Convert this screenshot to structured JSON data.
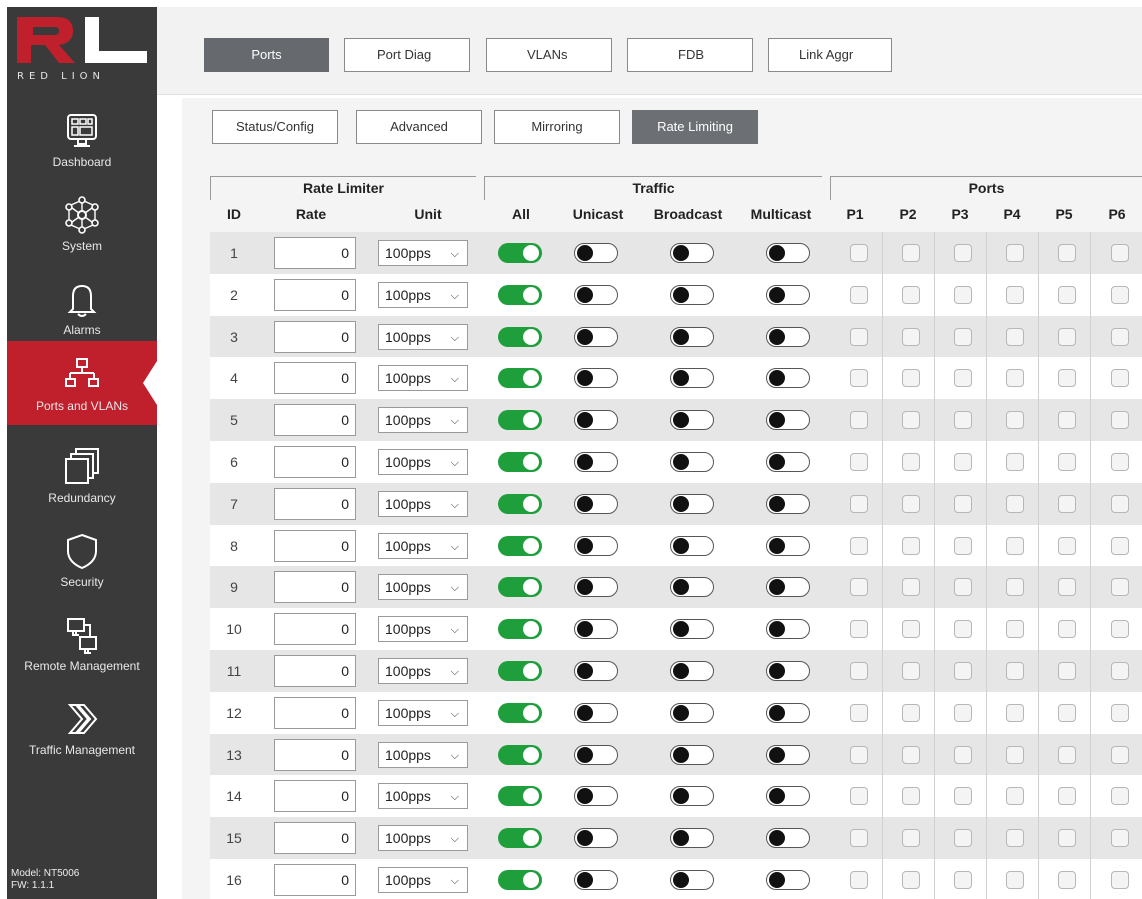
{
  "brand": {
    "logo_letters": "RL",
    "wordmark": "RED LION"
  },
  "sidebar": {
    "items": [
      {
        "label": "Dashboard",
        "icon": "dashboard-icon"
      },
      {
        "label": "System",
        "icon": "system-icon"
      },
      {
        "label": "Alarms",
        "icon": "bell-icon"
      },
      {
        "label": "Ports and VLANs",
        "icon": "network-icon",
        "active": true
      },
      {
        "label": "Redundancy",
        "icon": "redundancy-icon"
      },
      {
        "label": "Security",
        "icon": "shield-icon"
      },
      {
        "label": "Remote Management",
        "icon": "remote-management-icon"
      },
      {
        "label": "Traffic Management",
        "icon": "traffic-icon"
      }
    ],
    "model": "Model: NT5006",
    "fw": "FW: 1.1.1"
  },
  "top_tabs": [
    {
      "label": "Ports",
      "active": true
    },
    {
      "label": "Port Diag"
    },
    {
      "label": "VLANs"
    },
    {
      "label": "FDB"
    },
    {
      "label": "Link Aggr"
    }
  ],
  "sub_tabs": [
    {
      "label": "Status/Config"
    },
    {
      "label": "Advanced"
    },
    {
      "label": "Mirroring"
    },
    {
      "label": "Rate Limiting",
      "active": true
    }
  ],
  "table": {
    "groups": {
      "rate_limiter": "Rate Limiter",
      "traffic": "Traffic",
      "ports": "Ports"
    },
    "columns": {
      "id": "ID",
      "rate": "Rate",
      "unit": "Unit",
      "all": "All",
      "unicast": "Unicast",
      "broadcast": "Broadcast",
      "multicast": "Multicast"
    },
    "port_columns": [
      "P1",
      "P2",
      "P3",
      "P4",
      "P5",
      "P6"
    ],
    "rows": [
      {
        "id": "1",
        "rate": "0",
        "unit": "100pps",
        "all": true,
        "unicast": false,
        "broadcast": false,
        "multicast": false
      },
      {
        "id": "2",
        "rate": "0",
        "unit": "100pps",
        "all": true,
        "unicast": false,
        "broadcast": false,
        "multicast": false
      },
      {
        "id": "3",
        "rate": "0",
        "unit": "100pps",
        "all": true,
        "unicast": false,
        "broadcast": false,
        "multicast": false
      },
      {
        "id": "4",
        "rate": "0",
        "unit": "100pps",
        "all": true,
        "unicast": false,
        "broadcast": false,
        "multicast": false
      },
      {
        "id": "5",
        "rate": "0",
        "unit": "100pps",
        "all": true,
        "unicast": false,
        "broadcast": false,
        "multicast": false
      },
      {
        "id": "6",
        "rate": "0",
        "unit": "100pps",
        "all": true,
        "unicast": false,
        "broadcast": false,
        "multicast": false
      },
      {
        "id": "7",
        "rate": "0",
        "unit": "100pps",
        "all": true,
        "unicast": false,
        "broadcast": false,
        "multicast": false
      },
      {
        "id": "8",
        "rate": "0",
        "unit": "100pps",
        "all": true,
        "unicast": false,
        "broadcast": false,
        "multicast": false
      },
      {
        "id": "9",
        "rate": "0",
        "unit": "100pps",
        "all": true,
        "unicast": false,
        "broadcast": false,
        "multicast": false
      },
      {
        "id": "10",
        "rate": "0",
        "unit": "100pps",
        "all": true,
        "unicast": false,
        "broadcast": false,
        "multicast": false
      },
      {
        "id": "11",
        "rate": "0",
        "unit": "100pps",
        "all": true,
        "unicast": false,
        "broadcast": false,
        "multicast": false
      },
      {
        "id": "12",
        "rate": "0",
        "unit": "100pps",
        "all": true,
        "unicast": false,
        "broadcast": false,
        "multicast": false
      },
      {
        "id": "13",
        "rate": "0",
        "unit": "100pps",
        "all": true,
        "unicast": false,
        "broadcast": false,
        "multicast": false
      },
      {
        "id": "14",
        "rate": "0",
        "unit": "100pps",
        "all": true,
        "unicast": false,
        "broadcast": false,
        "multicast": false
      },
      {
        "id": "15",
        "rate": "0",
        "unit": "100pps",
        "all": true,
        "unicast": false,
        "broadcast": false,
        "multicast": false
      },
      {
        "id": "16",
        "rate": "0",
        "unit": "100pps",
        "all": true,
        "unicast": false,
        "broadcast": false,
        "multicast": false
      }
    ]
  },
  "colors": {
    "sidebar_bg": "#3a3a3a",
    "active_nav": "#c01f2c",
    "toggle_on": "#1e9f3c",
    "tab_active": "#66696d"
  }
}
